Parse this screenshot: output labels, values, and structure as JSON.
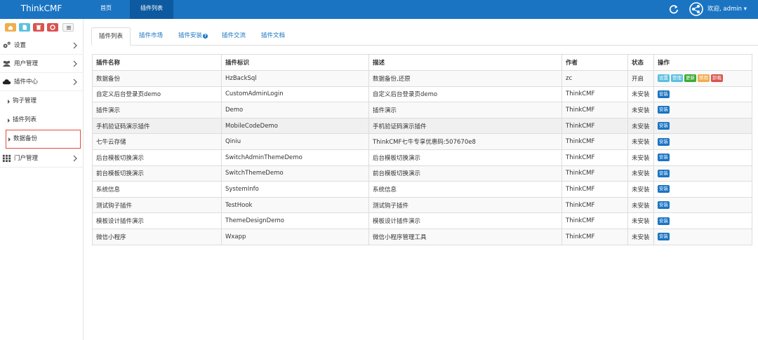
{
  "header": {
    "brand": "ThinkCMF",
    "nav": [
      {
        "label": "首页"
      },
      {
        "label": "插件列表"
      }
    ],
    "user": "欢迎, admin ▾"
  },
  "sidebar": {
    "toolbar": [
      {
        "icon": "home-icon",
        "color": "#f0ad4e"
      },
      {
        "icon": "file-icon",
        "color": "#5bc0de"
      },
      {
        "icon": "trash-icon",
        "color": "#d9534f"
      },
      {
        "icon": "recycle-icon",
        "color": "#d9534f"
      },
      {
        "icon": "list-icon",
        "color": "#f5f5f5"
      }
    ],
    "items": [
      {
        "label": "设置",
        "icon": "gears-icon"
      },
      {
        "label": "用户管理",
        "icon": "users-icon"
      },
      {
        "label": "插件中心",
        "icon": "cloud-icon"
      },
      {
        "label": "门户管理",
        "icon": "grid-icon"
      }
    ],
    "subitems": [
      {
        "label": "钩子管理"
      },
      {
        "label": "插件列表"
      },
      {
        "label": "数据备份"
      }
    ]
  },
  "tabs": [
    {
      "label": "插件列表"
    },
    {
      "label": "插件市场"
    },
    {
      "label": "插件安装"
    },
    {
      "label": "插件交流"
    },
    {
      "label": "插件文档"
    }
  ],
  "table": {
    "columns": [
      "插件名称",
      "插件标识",
      "描述",
      "作者",
      "状态",
      "操作"
    ],
    "rows": [
      {
        "name": "数据备份",
        "id": "HzBackSql",
        "desc": "数据备份,还原",
        "author": "zc",
        "status": "开启"
      },
      {
        "name": "自定义后台登录页demo",
        "id": "CustomAdminLogin",
        "desc": "自定义后台登录页demo",
        "author": "ThinkCMF",
        "status": "未安装"
      },
      {
        "name": "插件演示",
        "id": "Demo",
        "desc": "插件演示",
        "author": "ThinkCMF",
        "status": "未安装"
      },
      {
        "name": "手机验证码演示插件",
        "id": "MobileCodeDemo",
        "desc": "手机验证码演示插件",
        "author": "ThinkCMF",
        "status": "未安装"
      },
      {
        "name": "七牛云存储",
        "id": "Qiniu",
        "desc": "ThinkCMF七牛专享优惠码:507670e8",
        "author": "ThinkCMF",
        "status": "未安装"
      },
      {
        "name": "后台模板切换演示",
        "id": "SwitchAdminThemeDemo",
        "desc": "后台模板切换演示",
        "author": "ThinkCMF",
        "status": "未安装"
      },
      {
        "name": "前台模板切换演示",
        "id": "SwitchThemeDemo",
        "desc": "前台模板切换演示",
        "author": "ThinkCMF",
        "status": "未安装"
      },
      {
        "name": "系统信息",
        "id": "SystemInfo",
        "desc": "系统信息",
        "author": "ThinkCMF",
        "status": "未安装"
      },
      {
        "name": "测试钩子插件",
        "id": "TestHook",
        "desc": "测试钩子插件",
        "author": "ThinkCMF",
        "status": "未安装"
      },
      {
        "name": "模板设计插件演示",
        "id": "ThemeDesignDemo",
        "desc": "模板设计插件演示",
        "author": "ThinkCMF",
        "status": "未安装"
      },
      {
        "name": "微信小程序",
        "id": "Wxapp",
        "desc": "微信小程序管理工具",
        "author": "ThinkCMF",
        "status": "未安装"
      }
    ],
    "enabled_actions": [
      {
        "label": "设置",
        "color": "cyan"
      },
      {
        "label": "管理",
        "color": "cyan"
      },
      {
        "label": "更新",
        "color": "green"
      },
      {
        "label": "禁用",
        "color": "orange"
      },
      {
        "label": "卸载",
        "color": "red"
      }
    ],
    "install_label": "安装"
  }
}
